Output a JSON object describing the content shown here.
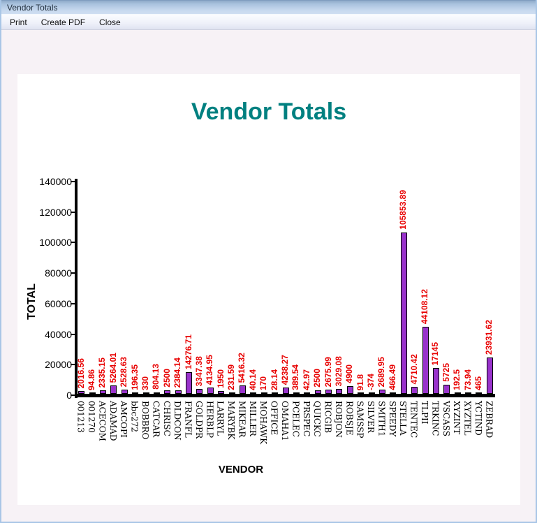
{
  "window": {
    "title": "Vendor Totals"
  },
  "menu": {
    "items": [
      {
        "label": "Print"
      },
      {
        "label": "Create PDF"
      },
      {
        "label": "Close"
      }
    ]
  },
  "chart_data": {
    "type": "bar",
    "title": "Vendor Totals",
    "xlabel": "VENDOR",
    "ylabel": "TOTAL",
    "ylim": [
      0,
      140000
    ],
    "y_ticks": [
      0,
      20000,
      40000,
      60000,
      80000,
      100000,
      120000,
      140000
    ],
    "grid": false,
    "legend": "none",
    "colors": {
      "bar_fill": "#9933CC",
      "bar_border": "#000000",
      "value_label": "#E80000",
      "title": "#008080",
      "axis": "#000000"
    },
    "categories": [
      "001213",
      "001270",
      "ACECOM",
      "ADAMAD",
      "AMCOPI",
      "bbc272",
      "BOBBRO",
      "CATCAR",
      "CHRISC",
      "DLDCON",
      "FRANFL",
      "GOLDPR",
      "HERBLP",
      "LARRYL",
      "MARYBK",
      "MIKEAR",
      "MILLER",
      "MOHAWK",
      "OFFICE",
      "OMAHA1",
      "PCELEC",
      "PRSPEC",
      "QUICKC",
      "RICGIB",
      "ROBJON",
      "ROBSJE",
      "SAMSSP",
      "SILVER",
      "SMITH1",
      "SPEEDY",
      "STELLA",
      "TENTEC",
      "TLPII",
      "TRKINC",
      "VSCASS",
      "XYZINT",
      "XYZTEL",
      "YCTIND",
      "ZEBRAD"
    ],
    "values": [
      2016.56,
      94.86,
      2335.15,
      5264.01,
      2528.63,
      196.35,
      330,
      804.13,
      2500,
      2384.14,
      14276.71,
      3347.38,
      4134.95,
      1950,
      231.59,
      5416.32,
      40.14,
      170,
      28.14,
      4238.27,
      389.54,
      42.97,
      2500,
      2675.99,
      3029.08,
      4900,
      91.8,
      -374,
      2689.95,
      466.49,
      105853.89,
      4710.42,
      44108.12,
      17145,
      5725,
      192.5,
      73.94,
      465,
      23931.62
    ],
    "value_labels": [
      "2016.56",
      "94.86",
      "2335.15",
      "5264.01",
      "2528.63",
      "196.35",
      "330",
      "804.13",
      "2500",
      "2384.14",
      "14276.71",
      "3347.38",
      "4134.95",
      "1950",
      "231.59",
      "5416.32",
      "40.14",
      "170",
      "28.14",
      "4238.27",
      "389.54",
      "42.97",
      "2500",
      "2675.99",
      "3029.08",
      "4900",
      "91.8",
      "-374",
      "2689.95",
      "466.49",
      "105853.89",
      "4710.42",
      "44108.12",
      "17145",
      "5725",
      "192.5",
      "73.94",
      "465",
      "23931.62"
    ]
  }
}
